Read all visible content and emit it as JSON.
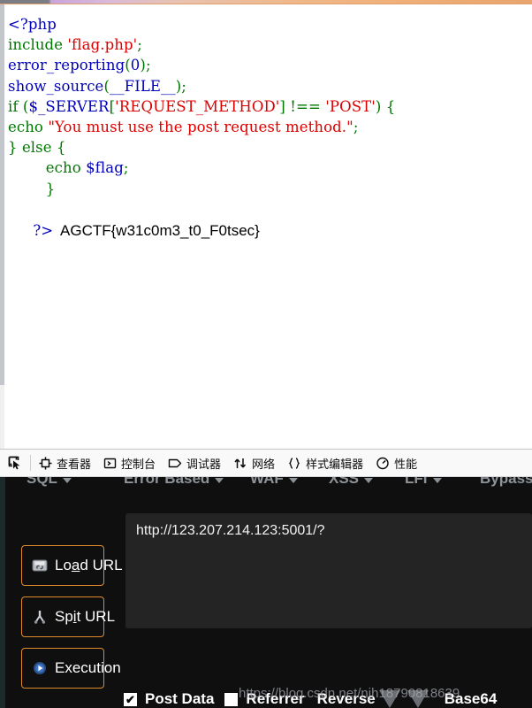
{
  "page": {
    "title": "PHP source view with HackBar and Firefox DevTools",
    "loading_bar_visible": true
  },
  "code_view": {
    "language": "php",
    "colors": {
      "keyword": "#007700",
      "string": "#dd0000",
      "default": "#0000bb",
      "background": "#ffffff"
    },
    "lines": [
      {
        "segments": [
          {
            "text": "<?php",
            "type": "tag"
          }
        ]
      },
      {
        "segments": [
          {
            "text": "include ",
            "type": "keyword"
          },
          {
            "text": "'flag.php'",
            "type": "string"
          },
          {
            "text": ";",
            "type": "keyword"
          }
        ]
      },
      {
        "segments": [
          {
            "text": "error_reporting",
            "type": "default"
          },
          {
            "text": "(",
            "type": "keyword"
          },
          {
            "text": "0",
            "type": "default"
          },
          {
            "text": ");",
            "type": "keyword"
          }
        ]
      },
      {
        "segments": [
          {
            "text": "show_source",
            "type": "default"
          },
          {
            "text": "(",
            "type": "keyword"
          },
          {
            "text": "__FILE__",
            "type": "default"
          },
          {
            "text": ");",
            "type": "keyword"
          }
        ]
      },
      {
        "segments": [
          {
            "text": "if (",
            "type": "keyword"
          },
          {
            "text": "$_SERVER",
            "type": "default"
          },
          {
            "text": "[",
            "type": "keyword"
          },
          {
            "text": "'REQUEST_METHOD'",
            "type": "string"
          },
          {
            "text": "] !== ",
            "type": "keyword"
          },
          {
            "text": "'POST'",
            "type": "string"
          },
          {
            "text": ") {",
            "type": "keyword"
          }
        ]
      },
      {
        "segments": [
          {
            "text": "echo ",
            "type": "keyword"
          },
          {
            "text": "\"You must use the post request method.\"",
            "type": "string"
          },
          {
            "text": ";",
            "type": "keyword"
          }
        ]
      },
      {
        "segments": [
          {
            "text": "} else {",
            "type": "keyword"
          }
        ]
      },
      {
        "segments": [
          {
            "text": "        echo ",
            "type": "keyword"
          },
          {
            "text": "$flag",
            "type": "default"
          },
          {
            "text": ";",
            "type": "keyword"
          }
        ]
      },
      {
        "segments": [
          {
            "text": "        }",
            "type": "keyword"
          }
        ]
      }
    ],
    "closing_tag": "?>",
    "flag_output": "AGCTF{w31c0m3_t0_F0tsec}"
  },
  "devtools": {
    "picker_icon": "element-picker-icon",
    "tabs": [
      {
        "label": "查看器",
        "icon": "inspector-icon"
      },
      {
        "label": "控制台",
        "icon": "console-icon"
      },
      {
        "label": "调试器",
        "icon": "debugger-icon"
      },
      {
        "label": "网络",
        "icon": "network-icon"
      },
      {
        "label": "样式编辑器",
        "icon": "style-editor-icon"
      },
      {
        "label": "性能",
        "icon": "performance-icon"
      }
    ]
  },
  "hackbar": {
    "accent_color": "#e08a2e",
    "background": "#0f0f10",
    "menu_items": [
      {
        "label": "SQL",
        "has_caret": true
      },
      {
        "label": "Error Based",
        "has_caret": true
      },
      {
        "label": "WAF",
        "has_caret": true
      },
      {
        "label": "XSS",
        "has_caret": true
      },
      {
        "label": "LFI",
        "has_caret": true
      },
      {
        "label": "Bypasse",
        "has_caret": false
      }
    ],
    "buttons": [
      {
        "label_before": "Lo",
        "label_accel": "a",
        "label_after": "d URL",
        "icon": "load-url-icon"
      },
      {
        "label_before": "Sp",
        "label_accel": "i",
        "label_after": "t URL",
        "icon": "split-url-icon"
      },
      {
        "label_before": "Execution",
        "label_accel": "",
        "label_after": "",
        "icon": "execution-icon"
      }
    ],
    "url_value": "http://123.207.214.123:5001/?",
    "options": [
      {
        "label": "Post Data",
        "checked": true,
        "check_glyph": "✔"
      },
      {
        "label": "Referrer",
        "checked": false,
        "check_glyph": ""
      }
    ],
    "dropdowns": [
      {
        "label": "Reverse"
      },
      {
        "label": "Base64"
      }
    ]
  },
  "watermark": {
    "text": "https://blog.csdn.net/njh18790818639"
  }
}
